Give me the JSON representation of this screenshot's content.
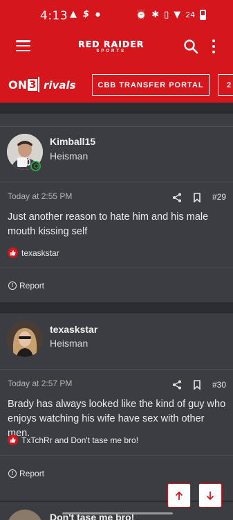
{
  "status_bar": {
    "time": "4:13",
    "icons": [
      "warning-icon",
      "dollar-icon",
      "dot-icon",
      "alarm-icon",
      "bluetooth-icon",
      "vibrate-icon",
      "wifi-icon",
      "signal-icon",
      "battery-icon"
    ],
    "battery_label": "24"
  },
  "header": {
    "logo_line1": "RED RAIDER",
    "logo_line2": "SPORTS",
    "brand_color": "#d5161c"
  },
  "brand_bar": {
    "on3_prefix": "ON",
    "on3_suffix": "3",
    "rivals": "rivals",
    "pills": [
      "CBB TRANSFER PORTAL",
      "2"
    ]
  },
  "posts": [
    {
      "username": "Kimball15",
      "user_title": "Heisman",
      "timestamp": "Today at 2:55 PM",
      "post_number": "#29",
      "body": "Just another reason to hate him and his male mouth kissing self",
      "reactions": "texaskstar",
      "report_label": "Report"
    },
    {
      "username": "texaskstar",
      "user_title": "Heisman",
      "timestamp": "Today at 2:57 PM",
      "post_number": "#30",
      "body": "Brady has always looked like the kind of guy who enjoys watching his wife have sex with other men.",
      "reactions": "TxTchRr and Don't tase me bro!",
      "report_label": "Report"
    },
    {
      "username": "Don't tase me bro!"
    }
  ]
}
